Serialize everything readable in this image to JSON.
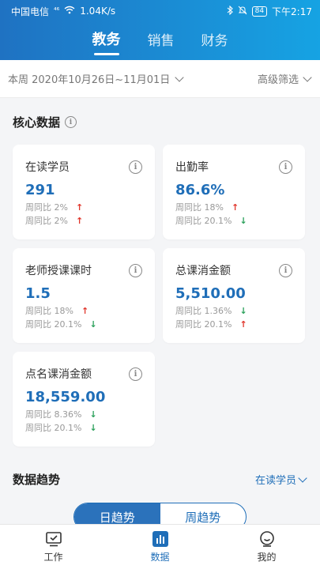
{
  "status_bar": {
    "carrier": "中国电信",
    "signal": "⁴⁶",
    "speed": "1.04K/s",
    "battery": "84",
    "time": "下午2:17"
  },
  "top_tabs": [
    "教务",
    "销售",
    "财务"
  ],
  "filter": {
    "date_range": "本周 2020年10月26日~11月01日",
    "advanced": "高级筛选"
  },
  "core_section": {
    "title": "核心数据",
    "cards": [
      {
        "title": "在读学员",
        "value": "291",
        "compare": [
          {
            "text": "周同比 2%",
            "dir": "up"
          },
          {
            "text": "周同比 2%",
            "dir": "up"
          }
        ]
      },
      {
        "title": "出勤率",
        "value": "86.6%",
        "compare": [
          {
            "text": "周同比 18%",
            "dir": "up"
          },
          {
            "text": "周同比 20.1%",
            "dir": "down"
          }
        ]
      },
      {
        "title": "老师授课课时",
        "value": "1.5",
        "compare": [
          {
            "text": "周同比 18%",
            "dir": "up"
          },
          {
            "text": "周同比 20.1%",
            "dir": "down"
          }
        ]
      },
      {
        "title": "总课消金额",
        "value": "5,510.00",
        "compare": [
          {
            "text": "周同比 1.36%",
            "dir": "down"
          },
          {
            "text": "周同比 20.1%",
            "dir": "up"
          }
        ]
      },
      {
        "title": "点名课消金额",
        "value": "18,559.00",
        "compare": [
          {
            "text": "周同比 8.36%",
            "dir": "down"
          },
          {
            "text": "周同比 20.1%",
            "dir": "down"
          }
        ]
      }
    ]
  },
  "trend_section": {
    "title": "数据趋势",
    "metric": "在读学员",
    "segments": [
      "日趋势",
      "周趋势"
    ]
  },
  "bottom_nav": [
    "工作",
    "数据",
    "我的"
  ],
  "colors": {
    "accent": "#1f6eb8",
    "up": "#e0352b",
    "down": "#2aa05a"
  }
}
